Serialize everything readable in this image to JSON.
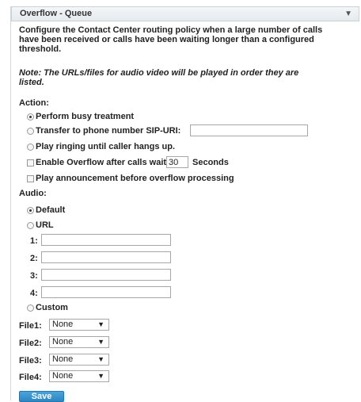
{
  "header": {
    "title": "Overflow - Queue",
    "collapse_icon": "▼"
  },
  "description": "Configure the Contact Center routing policy when a large number of calls have been received or calls have been waiting longer than a configured threshold.",
  "note": "Note: The URLs/files for audio video will be played in order they are listed.",
  "action": {
    "label": "Action:",
    "perform_busy": "Perform busy treatment",
    "transfer": "Transfer to phone number SIP-URI:",
    "transfer_value": "",
    "play_ringing": "Play ringing until caller hangs up.",
    "enable_overflow_before": "Enable Overflow after calls wait",
    "wait_value": "30",
    "enable_overflow_after": "Seconds",
    "play_announcement": "Play announcement before overflow processing"
  },
  "audio": {
    "label": "Audio:",
    "default": "Default",
    "url": "URL",
    "url_fields": [
      {
        "label": "1:",
        "value": ""
      },
      {
        "label": "2:",
        "value": ""
      },
      {
        "label": "3:",
        "value": ""
      },
      {
        "label": "4:",
        "value": ""
      }
    ],
    "custom": "Custom",
    "files": [
      {
        "label": "File1:",
        "value": "None"
      },
      {
        "label": "File2:",
        "value": "None"
      },
      {
        "label": "File3:",
        "value": "None"
      },
      {
        "label": "File4:",
        "value": "None"
      }
    ],
    "dropdown_arrow": "▼"
  },
  "save_label": "Save"
}
